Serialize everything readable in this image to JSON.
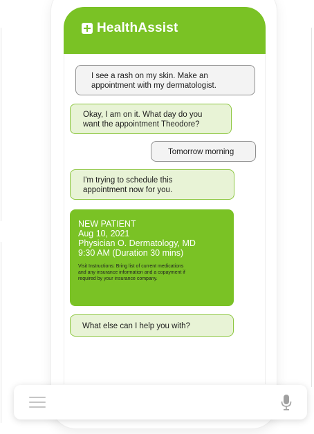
{
  "app": {
    "title": "HealthAssist",
    "brand_color": "#7ac225",
    "icon": "plus-icon"
  },
  "messages": [
    {
      "sender": "user",
      "lines": [
        "I see a rash on my skin. Make an",
        "appointment with my dermatologist."
      ]
    },
    {
      "sender": "bot",
      "lines": [
        "Okay, I am on it. What day do you",
        "want the appointment Theodore?"
      ]
    },
    {
      "sender": "user",
      "lines": [
        "Tomorrow morning"
      ]
    },
    {
      "sender": "bot",
      "lines": [
        "I'm trying to schedule this",
        "appointment now for you."
      ]
    },
    {
      "sender": "bot",
      "lines": [
        "What else can I help you with?"
      ]
    }
  ],
  "appointment_card": {
    "status": "NEW PATIENT",
    "date": "Aug 10, 2021",
    "physician": "Physician O. Dermatology, MD",
    "time": "9:30 AM (Duration 30 mins)",
    "instructions_lines": [
      "Visit Instructions: Bring list of current medications",
      "and any insurance information and a copayment if",
      "required by your insurance company."
    ]
  },
  "input_bar": {
    "left_icon": "menu-icon",
    "right_icon": "microphone-icon"
  }
}
